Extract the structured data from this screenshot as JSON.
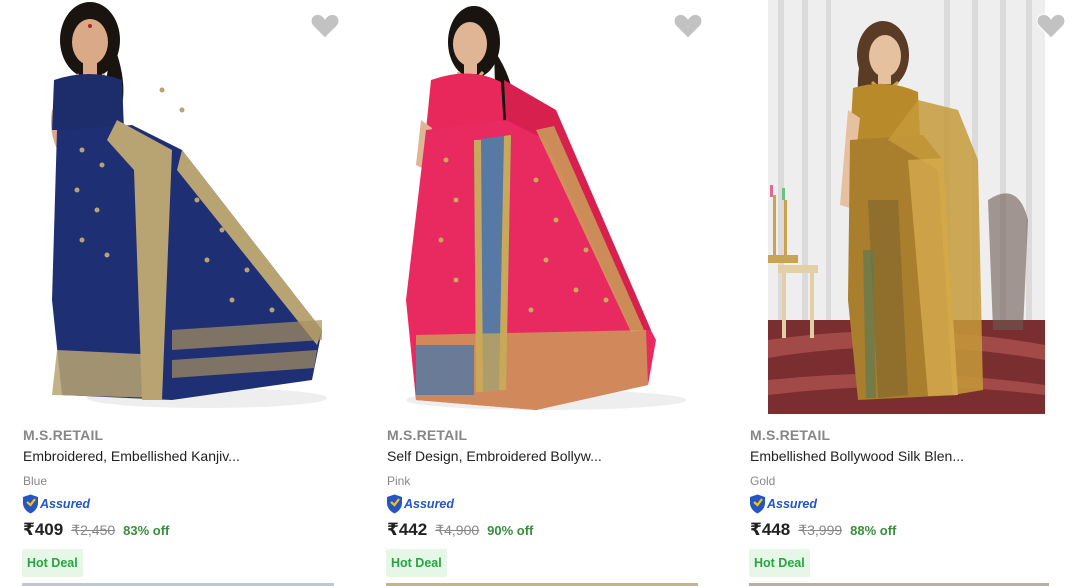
{
  "products": [
    {
      "brand": "M.S.RETAIL",
      "title": "Embroidered, Embellished Kanjiv...",
      "color": "Blue",
      "assured_label": "Assured",
      "price": "₹409",
      "mrp": "₹2,450",
      "discount": "83% off",
      "deal_label": "Hot Deal",
      "wishlist_icon": "heart-icon",
      "image_desc": "navy-blue-saree"
    },
    {
      "brand": "M.S.RETAIL",
      "title": "Self Design, Embroidered Bollyw...",
      "color": "Pink",
      "assured_label": "Assured",
      "price": "₹442",
      "mrp": "₹4,900",
      "discount": "90% off",
      "deal_label": "Hot Deal",
      "wishlist_icon": "heart-icon",
      "image_desc": "pink-saree"
    },
    {
      "brand": "M.S.RETAIL",
      "title": "Embellished Bollywood Silk Blen...",
      "color": "Gold",
      "assured_label": "Assured",
      "price": "₹448",
      "mrp": "₹3,999",
      "discount": "88% off",
      "deal_label": "Hot Deal",
      "wishlist_icon": "heart-icon",
      "image_desc": "gold-saree"
    }
  ],
  "colors": {
    "brand_text": "#878787",
    "title_text": "#212121",
    "assured_blue": "#2455c3",
    "discount_green": "#388e3c",
    "deal_bg": "#e6f7e8",
    "deal_text": "#26a541",
    "wishlist_grey": "#c2c2c2"
  }
}
